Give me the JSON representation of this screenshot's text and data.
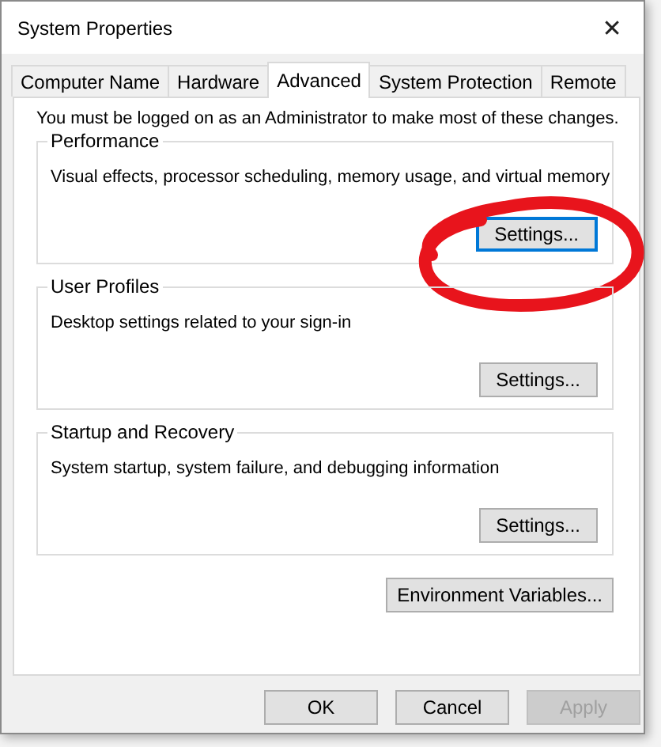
{
  "window": {
    "title": "System Properties",
    "close": "✕"
  },
  "tabs": [
    {
      "label": "Computer Name",
      "selected": false
    },
    {
      "label": "Hardware",
      "selected": false
    },
    {
      "label": "Advanced",
      "selected": true
    },
    {
      "label": "System Protection",
      "selected": false
    },
    {
      "label": "Remote",
      "selected": false
    }
  ],
  "notice": "You must be logged on as an Administrator to make most of these changes.",
  "groups": [
    {
      "title": "Performance",
      "description": "Visual effects, processor scheduling, memory usage, and virtual memory",
      "button": "Settings...",
      "focused": true,
      "circled": true
    },
    {
      "title": "User Profiles",
      "description": "Desktop settings related to your sign-in",
      "button": "Settings...",
      "focused": false,
      "circled": false
    },
    {
      "title": "Startup and Recovery",
      "description": "System startup, system failure, and debugging information",
      "button": "Settings...",
      "focused": false,
      "circled": false
    }
  ],
  "environment_button": "Environment Variables...",
  "buttons": [
    {
      "label": "OK",
      "disabled": false
    },
    {
      "label": "Cancel",
      "disabled": false
    },
    {
      "label": "Apply",
      "disabled": true
    }
  ]
}
